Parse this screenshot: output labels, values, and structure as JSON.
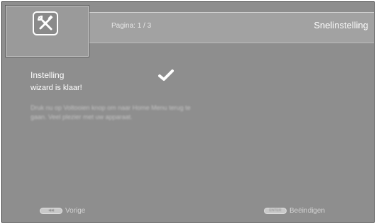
{
  "header": {
    "page_indicator": "Pagina: 1 / 3",
    "title": "Snelinstelling"
  },
  "icon": {
    "name": "settings-tools-icon"
  },
  "content": {
    "title_line1": "Instelling",
    "title_line2": "wizard is klaar!",
    "message": "Druk nu op Voltooien knop om naar Home Menu terug te gaan. Veel plezier met uw apparaat."
  },
  "footer": {
    "back_key": "◀◀",
    "back_label": "Vorige",
    "finish_key": "ENTER",
    "finish_label": "Beëindigen"
  },
  "colors": {
    "background": "#8e8e8e",
    "header_bar": "#a2a2a2",
    "text": "#ffffff"
  }
}
